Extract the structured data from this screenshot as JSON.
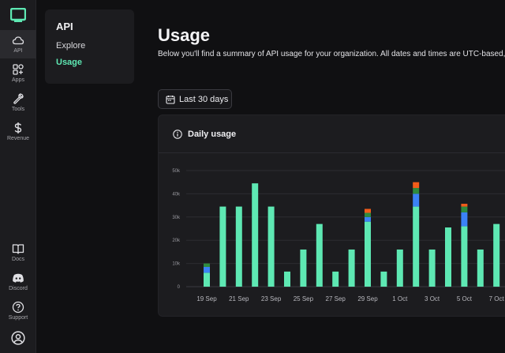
{
  "rail": {
    "items": [
      {
        "label": "API",
        "icon": "cloud-icon",
        "active": true
      },
      {
        "label": "Apps",
        "icon": "apps-grid-icon",
        "active": false
      },
      {
        "label": "Tools",
        "icon": "wrench-icon",
        "active": false
      },
      {
        "label": "Revenue",
        "icon": "dollar-icon",
        "active": false
      }
    ],
    "bottom_items": [
      {
        "label": "Docs",
        "icon": "book-icon"
      },
      {
        "label": "Discord",
        "icon": "discord-icon"
      },
      {
        "label": "Support",
        "icon": "help-icon"
      }
    ],
    "account_icon": "account-icon"
  },
  "subnav": {
    "title": "API",
    "items": [
      {
        "label": "Explore",
        "active": false
      },
      {
        "label": "Usage",
        "active": true
      }
    ]
  },
  "main": {
    "title": "Usage",
    "description": "Below you'll find a summary of API usage for your organization. All dates and times are UTC-based,",
    "date_range_label": "Last 30 days",
    "card_title": "Daily usage"
  },
  "colors": {
    "accent": "#5ee8b3",
    "series_primary": "#5ee8b3",
    "series_secondary": "#3b82f6",
    "series_tertiary": "#2e8b3e",
    "series_quaternary": "#f25c1a"
  },
  "chart_data": {
    "type": "bar",
    "stacked": true,
    "title": "Daily usage",
    "ylim": [
      0,
      50000
    ],
    "yticks": [
      "0",
      "10k",
      "20k",
      "30k",
      "40k",
      "50k"
    ],
    "ytick_values": [
      0,
      10000,
      20000,
      30000,
      40000,
      50000
    ],
    "grid": true,
    "x_tick_labels": [
      "19 Sep",
      "21 Sep",
      "23 Sep",
      "25 Sep",
      "27 Sep",
      "29 Sep",
      "1 Oct",
      "3 Oct",
      "5 Oct",
      "7 Oct"
    ],
    "categories": [
      "19 Sep",
      "20 Sep",
      "21 Sep",
      "22 Sep",
      "23 Sep",
      "24 Sep",
      "25 Sep",
      "26 Sep",
      "27 Sep",
      "28 Sep",
      "29 Sep",
      "30 Sep",
      "1 Oct",
      "2 Oct",
      "3 Oct",
      "4 Oct",
      "5 Oct",
      "6 Oct",
      "7 Oct"
    ],
    "series": [
      {
        "color": "#5ee8b3",
        "values": [
          6000,
          34500,
          34500,
          44500,
          34500,
          6500,
          16000,
          27000,
          6500,
          16000,
          28000,
          6500,
          16000,
          34500,
          16000,
          25500,
          26000,
          16000,
          27000
        ]
      },
      {
        "color": "#3b82f6",
        "values": [
          2500,
          0,
          0,
          0,
          0,
          0,
          0,
          0,
          0,
          0,
          2000,
          0,
          0,
          5500,
          0,
          0,
          6000,
          0,
          0
        ]
      },
      {
        "color": "#2e8b3e",
        "values": [
          1500,
          0,
          0,
          0,
          0,
          0,
          0,
          0,
          0,
          0,
          1800,
          0,
          0,
          2500,
          0,
          0,
          2500,
          0,
          0
        ]
      },
      {
        "color": "#f25c1a",
        "values": [
          0,
          0,
          0,
          0,
          0,
          0,
          0,
          0,
          0,
          0,
          1700,
          0,
          0,
          2500,
          0,
          0,
          1200,
          0,
          0
        ]
      }
    ]
  }
}
